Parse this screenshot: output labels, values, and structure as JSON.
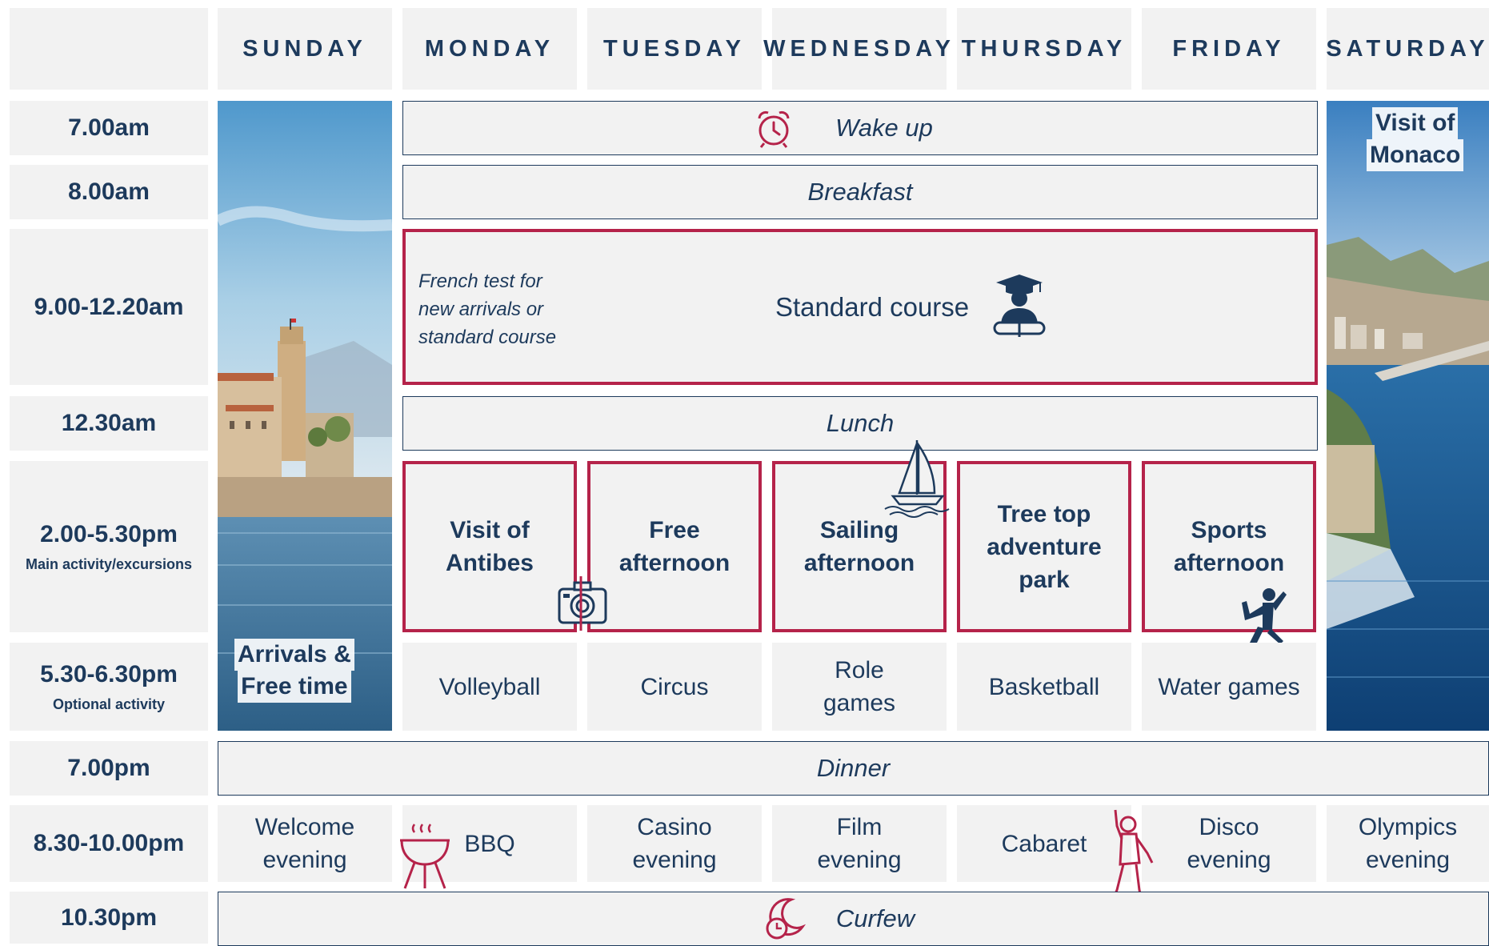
{
  "days": [
    "SUNDAY",
    "MONDAY",
    "TUESDAY",
    "WEDNESDAY",
    "THURSDAY",
    "FRIDAY",
    "SATURDAY"
  ],
  "times": [
    {
      "label": "7.00am",
      "sub": ""
    },
    {
      "label": "8.00am",
      "sub": ""
    },
    {
      "label": "9.00-12.20am",
      "sub": ""
    },
    {
      "label": "12.30am",
      "sub": ""
    },
    {
      "label": "2.00-5.30pm",
      "sub": "Main activity/excursions"
    },
    {
      "label": "5.30-6.30pm",
      "sub": "Optional activity"
    },
    {
      "label": "7.00pm",
      "sub": ""
    },
    {
      "label": "8.30-10.00pm",
      "sub": ""
    },
    {
      "label": "10.30pm",
      "sub": ""
    }
  ],
  "sunday_photo": {
    "caption_line1": "Arrivals &",
    "caption_line2": "Free time"
  },
  "saturday_photo": {
    "caption_line1": "Visit of",
    "caption_line2": "Monaco"
  },
  "wake_up": "Wake up",
  "breakfast": "Breakfast",
  "course": {
    "note_line1": "French test for",
    "note_line2": "new arrivals or",
    "note_line3": "standard course",
    "title": "Standard course"
  },
  "lunch": "Lunch",
  "afternoon": [
    {
      "lines": [
        "Visit of",
        "Antibes"
      ]
    },
    {
      "lines": [
        "Free",
        "afternoon"
      ]
    },
    {
      "lines": [
        "Sailing",
        "afternoon"
      ]
    },
    {
      "lines": [
        "Tree top",
        "adventure",
        "park"
      ]
    },
    {
      "lines": [
        "Sports",
        "afternoon"
      ]
    }
  ],
  "optional": [
    {
      "lines": [
        "Volleyball"
      ]
    },
    {
      "lines": [
        "Circus"
      ]
    },
    {
      "lines": [
        "Role",
        "games"
      ]
    },
    {
      "lines": [
        "Basketball"
      ]
    },
    {
      "lines": [
        "Water games"
      ]
    }
  ],
  "dinner": "Dinner",
  "evening": [
    {
      "lines": [
        "Welcome",
        "evening"
      ]
    },
    {
      "lines": [
        "BBQ"
      ]
    },
    {
      "lines": [
        "Casino",
        "evening"
      ]
    },
    {
      "lines": [
        "Film",
        "evening"
      ]
    },
    {
      "lines": [
        "Cabaret"
      ]
    },
    {
      "lines": [
        "Disco",
        "evening"
      ]
    },
    {
      "lines": [
        "Olympics",
        "evening"
      ]
    }
  ],
  "curfew": "Curfew",
  "colors": {
    "navy": "#1d3a5c",
    "red": "#b5234a",
    "cell": "#f2f2f2"
  }
}
